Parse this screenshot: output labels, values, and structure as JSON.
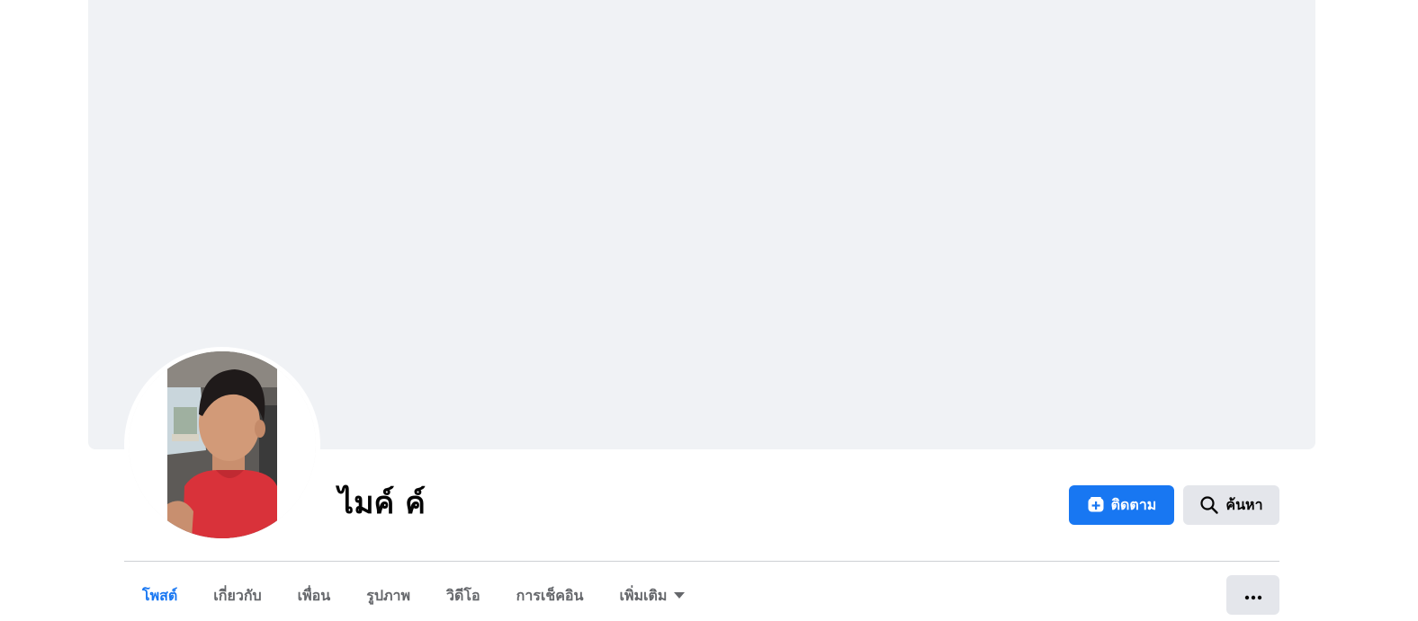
{
  "profile": {
    "name": "ไมค์ ค์"
  },
  "actions": {
    "follow_label": "ติดตาม",
    "search_label": "ค้นหา"
  },
  "tabs": [
    {
      "label": "โพสต์",
      "active": true
    },
    {
      "label": "เกี่ยวกับ",
      "active": false
    },
    {
      "label": "เพื่อน",
      "active": false
    },
    {
      "label": "รูปภาพ",
      "active": false
    },
    {
      "label": "วิดีโอ",
      "active": false
    },
    {
      "label": "การเช็คอิน",
      "active": false
    },
    {
      "label": "เพิ่มเติม",
      "active": false
    }
  ],
  "icons": {
    "follow": "follow-add-icon",
    "search": "search-icon",
    "more_caret": "caret-down-icon",
    "overflow": "more-dots-icon"
  },
  "colors": {
    "accent": "#1877f2",
    "cover_background": "#f0f2f5",
    "secondary_button": "#e4e6eb",
    "tab_inactive": "#65676b",
    "name_text": "#050505"
  }
}
